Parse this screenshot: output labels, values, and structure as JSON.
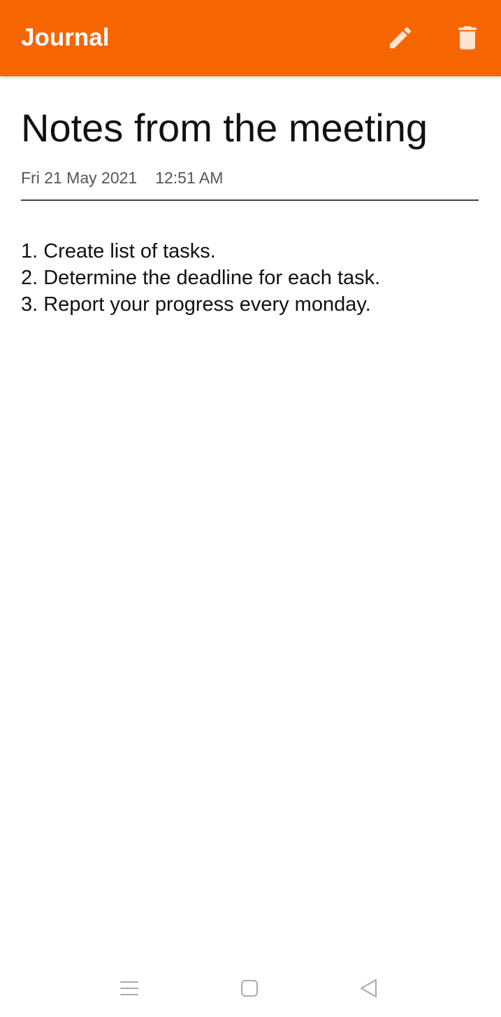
{
  "app_bar": {
    "title": "Journal",
    "background_color": "#f66600",
    "actions": [
      {
        "icon": "pencil-icon",
        "action": "edit"
      },
      {
        "icon": "trash-icon",
        "action": "delete"
      }
    ]
  },
  "note": {
    "title": "Notes from the meeting",
    "date": "Fri 21 May 2021",
    "time": "12:51 AM",
    "body_lines": [
      "1. Create list of tasks.",
      "2. Determine the deadline for each task.",
      "3. Report your progress every monday."
    ]
  },
  "navigation_bar": {
    "buttons": [
      {
        "icon": "menu-lines-icon",
        "action": "recents"
      },
      {
        "icon": "square-home-icon",
        "action": "home"
      },
      {
        "icon": "triangle-back-icon",
        "action": "back"
      }
    ]
  }
}
